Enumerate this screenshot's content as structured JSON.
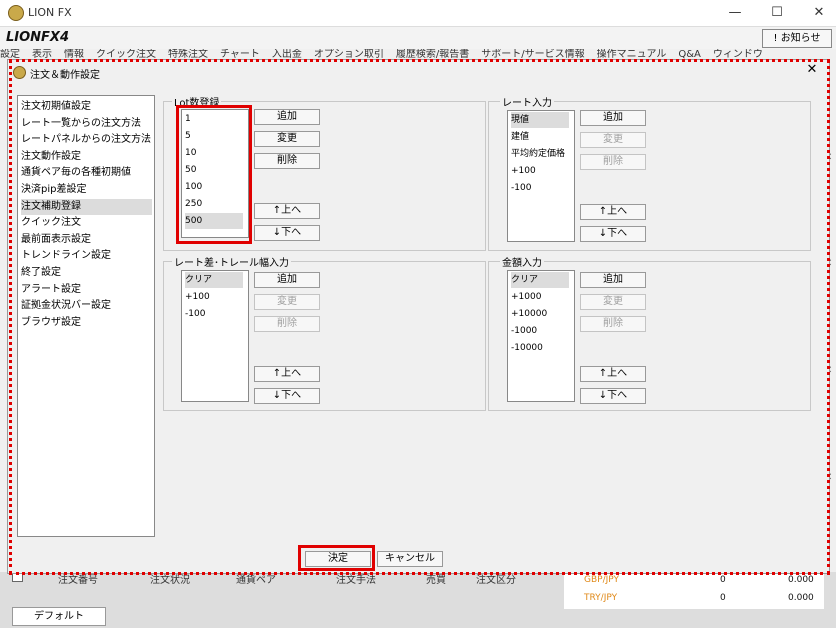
{
  "window": {
    "title": "LION FX",
    "brand": "LIONFX4",
    "notice_label": "! お知らせ"
  },
  "menu": [
    "設定",
    "表示",
    "情報",
    "クイック注文",
    "特殊注文",
    "チャート",
    "入出金",
    "オプション取引",
    "履歴検索/報告書",
    "サポート/サービス情報",
    "操作マニュアル",
    "Q&A",
    "ウィンドウ"
  ],
  "dialog": {
    "title": "注文＆動作設定",
    "nav": [
      "注文初期値設定",
      "レート一覧からの注文方法",
      "レートパネルからの注文方法",
      "注文動作設定",
      "通貨ペア毎の各種初期値",
      "決済pip差設定",
      "注文補助登録",
      "クイック注文",
      "最前面表示設定",
      "トレンドライン設定",
      "終了設定",
      "アラート設定",
      "証拠金状況バー設定",
      "ブラウザ設定"
    ],
    "nav_selected": 6,
    "groups": {
      "lot": {
        "label": "Lot数登録",
        "items": [
          "1",
          "5",
          "10",
          "50",
          "100",
          "250",
          "500"
        ],
        "selected": 6
      },
      "rate": {
        "label": "レート入力",
        "items": [
          "現値",
          "建値",
          "平均約定価格",
          "+100",
          "-100"
        ],
        "selected": 0
      },
      "trail": {
        "label": "レート差･トレール幅入力",
        "items": [
          "クリア",
          "+100",
          "-100"
        ],
        "selected": 0
      },
      "amount": {
        "label": "金額入力",
        "items": [
          "クリア",
          "+1000",
          "+10000",
          "-1000",
          "-10000"
        ],
        "selected": 0
      }
    },
    "buttons": {
      "add": "追加",
      "change": "変更",
      "delete": "削除",
      "up": "↑上へ",
      "down": "↓下へ",
      "ok": "決定",
      "cancel": "キャンセル"
    }
  },
  "orders_header": [
    "注文番号",
    "注文状況",
    "通貨ペア",
    "注文手法",
    "売買",
    "注文区分"
  ],
  "market": [
    {
      "pair": "GBP/JPY",
      "qty": "0",
      "value": "0.000"
    },
    {
      "pair": "TRY/JPY",
      "qty": "0",
      "value": "0.000"
    }
  ],
  "tab_label": "デフォルト"
}
